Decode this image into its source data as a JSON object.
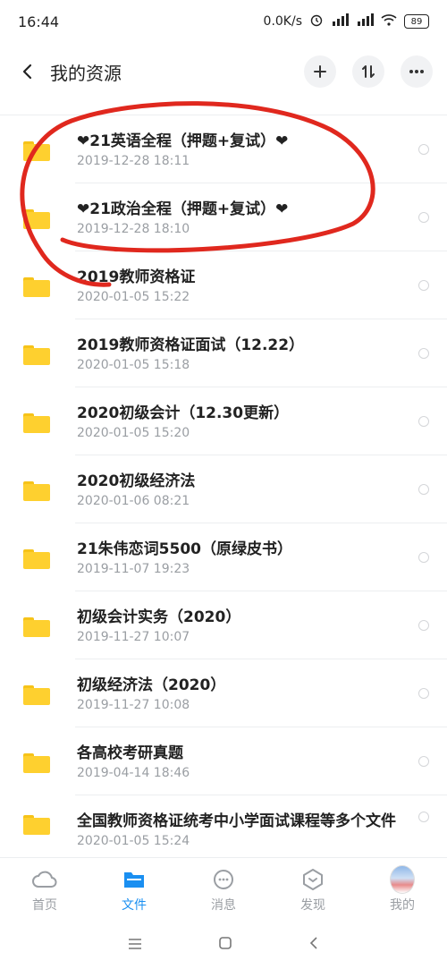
{
  "status_bar": {
    "time": "16:44",
    "net_speed": "0.0K/s",
    "battery": "89"
  },
  "header": {
    "title": "我的资源"
  },
  "files": [
    {
      "name": "❤21英语全程（押题+复试）❤",
      "date": "2019-12-28  18:11"
    },
    {
      "name": "❤21政治全程（押题+复试）❤",
      "date": "2019-12-28  18:10"
    },
    {
      "name": "2019教师资格证",
      "date": "2020-01-05  15:22"
    },
    {
      "name": "2019教师资格证面试（12.22）",
      "date": "2020-01-05  15:18"
    },
    {
      "name": "2020初级会计（12.30更新）",
      "date": "2020-01-05  15:20"
    },
    {
      "name": "2020初级经济法",
      "date": "2020-01-06  08:21"
    },
    {
      "name": "21朱伟恋词5500（原绿皮书）",
      "date": "2019-11-07  19:23"
    },
    {
      "name": "初级会计实务（2020）",
      "date": "2019-11-27  10:07"
    },
    {
      "name": "初级经济法（2020）",
      "date": "2019-11-27  10:08"
    },
    {
      "name": "各高校考研真题",
      "date": "2019-04-14  18:46"
    },
    {
      "name": "全国教师资格证统考中小学面试课程等多个文件",
      "date": "2020-01-05  15:24"
    }
  ],
  "tabbar": {
    "items": [
      {
        "label": "首页"
      },
      {
        "label": "文件"
      },
      {
        "label": "消息"
      },
      {
        "label": "发现"
      },
      {
        "label": "我的"
      }
    ]
  },
  "colors": {
    "accent": "#1a8ff1",
    "folder": "#fed02f",
    "annotation": "#e0281e"
  }
}
